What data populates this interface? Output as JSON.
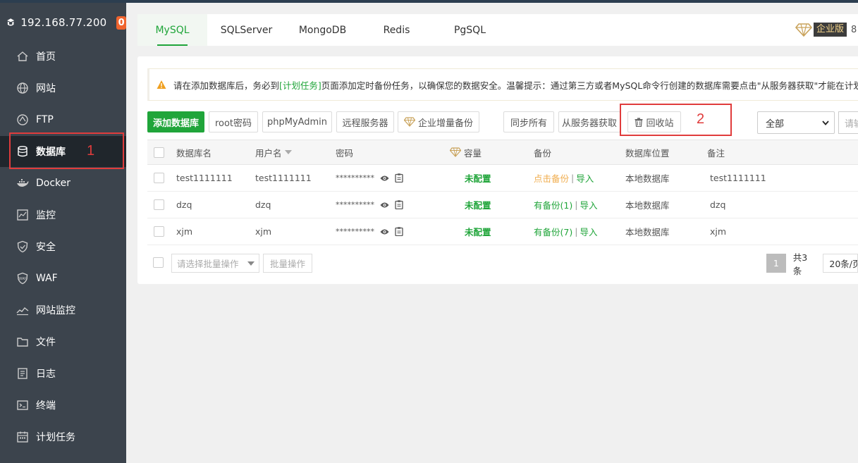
{
  "sidebar": {
    "host": "192.168.77.200",
    "badge": "0",
    "items": [
      {
        "label": "首页",
        "icon": "home-icon"
      },
      {
        "label": "网站",
        "icon": "globe-icon"
      },
      {
        "label": "FTP",
        "icon": "ftp-icon"
      },
      {
        "label": "数据库",
        "icon": "database-icon",
        "active": true
      },
      {
        "label": "Docker",
        "icon": "docker-icon"
      },
      {
        "label": "监控",
        "icon": "monitor-icon"
      },
      {
        "label": "安全",
        "icon": "shield-icon"
      },
      {
        "label": "WAF",
        "icon": "waf-icon"
      },
      {
        "label": "网站监控",
        "icon": "chart-line-icon"
      },
      {
        "label": "文件",
        "icon": "folder-icon"
      },
      {
        "label": "日志",
        "icon": "log-icon"
      },
      {
        "label": "终端",
        "icon": "terminal-icon"
      },
      {
        "label": "计划任务",
        "icon": "calendar-icon"
      }
    ]
  },
  "annotations": {
    "one": "1",
    "two": "2"
  },
  "tabs": [
    {
      "label": "MySQL",
      "active": true
    },
    {
      "label": "SQLServer"
    },
    {
      "label": "MongoDB"
    },
    {
      "label": "Redis"
    },
    {
      "label": "PgSQL"
    }
  ],
  "enterprise": {
    "label": "企业版",
    "num": "8"
  },
  "alert": {
    "prefix": "请在添加数据库后，务必到",
    "link": "[计划任务]",
    "suffix": "页面添加定时备份任务，以确保您的数据安全。温馨提示：通过第三方或者MySQL命令行创建的数据库需要点击\"从服务器获取\"才能在计划任务中"
  },
  "toolbar": {
    "add_db": "添加数据库",
    "root_pw": "root密码",
    "phpmyadmin": "phpMyAdmin",
    "remote": "远程服务器",
    "ent_backup": "企业增量备份",
    "sync_all": "同步所有",
    "fetch": "从服务器获取",
    "recycle": "回收站",
    "filter_selected": "全部",
    "search_placeholder": "请输"
  },
  "table": {
    "headers": {
      "name": "数据库名",
      "user": "用户名",
      "password": "密码",
      "capacity": "容量",
      "backup": "备份",
      "location": "数据库位置",
      "remark": "备注"
    },
    "rows": [
      {
        "name": "test1111111",
        "user": "test1111111",
        "password": "**********",
        "capacity": "未配置",
        "backup": "点击备份",
        "backup_type": "none",
        "import": "导入",
        "location": "本地数据库",
        "remark": "test1111111"
      },
      {
        "name": "dzq",
        "user": "dzq",
        "password": "**********",
        "capacity": "未配置",
        "backup": "有备份(1)",
        "backup_type": "has",
        "import": "导入",
        "location": "本地数据库",
        "remark": "dzq"
      },
      {
        "name": "xjm",
        "user": "xjm",
        "password": "**********",
        "capacity": "未配置",
        "backup": "有备份(7)",
        "backup_type": "has",
        "import": "导入",
        "location": "本地数据库",
        "remark": "xjm"
      }
    ]
  },
  "footer": {
    "batch_placeholder": "请选择批量操作",
    "batch_button": "批量操作",
    "page_current": "1",
    "page_total": "共3条",
    "page_size": "20条/页"
  },
  "colors": {
    "accent": "#20a53a",
    "sidebar": "#3c444d",
    "annotation": "#e03c3c"
  }
}
